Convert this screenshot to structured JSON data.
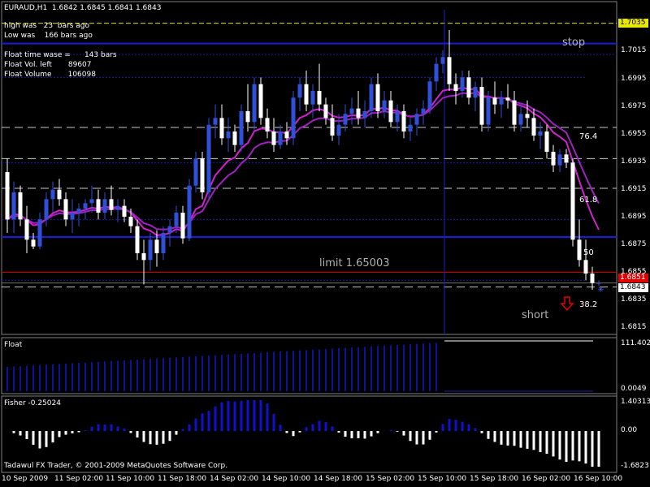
{
  "header": {
    "symbol_line": "EURAUD,H1  1.6842 1.6845 1.6841 1.6843",
    "high_was": "high was   23  bars ago",
    "low_was": "Low was    166 bars ago",
    "float_time": "Float time wase =      143 bars",
    "float_vol_left": "Float Vol. left       89607",
    "float_volume": "Float Volume       106098"
  },
  "labels": {
    "stop": "stop",
    "limit": "limit   1.65003",
    "short": "short",
    "fib_764": "76.4",
    "fib_618": "61.8",
    "fib_50": "50",
    "fib_382": "38.2"
  },
  "price_tags": {
    "high": "1.7035",
    "red": "1.6851",
    "current": "1.6843"
  },
  "y_ticks": [
    "1.7015",
    "1.6995",
    "1.6975",
    "1.6955",
    "1.6935",
    "1.6915",
    "1.6895",
    "1.6875",
    "1.6855",
    "1.6835",
    "1.6815"
  ],
  "x_ticks": [
    "10 Sep 2009",
    "11 Sep 02:00",
    "11 Sep 10:00",
    "11 Sep 18:00",
    "14 Sep 02:00",
    "14 Sep 10:00",
    "14 Sep 18:00",
    "15 Sep 02:00",
    "15 Sep 10:00",
    "15 Sep 18:00",
    "16 Sep 02:00",
    "16 Sep 10:00"
  ],
  "float_panel": {
    "title": "Float",
    "top_value": "111.4029",
    "bottom_value": "0.0049"
  },
  "fisher_panel": {
    "title": "Fisher -0.25024",
    "top_value": "1.40313",
    "zero_value": "0.00",
    "bottom_value": "-1.6823"
  },
  "copyright": "Tadawul FX Trader, © 2001-2009 MetaQuotes Software Corp.",
  "colors": {
    "bull": "#3050d8",
    "bear": "#ffffff",
    "ma": "#d020d0",
    "ma_slow": "#a020c0",
    "level_blue": "#1c1cd8",
    "hist_blue": "#1010a0",
    "high_line": "#e0e000",
    "red": "#e00000"
  },
  "chart_data": {
    "type": "candlestick",
    "symbol": "EURAUD",
    "timeframe": "H1",
    "ylim": [
      1.6805,
      1.7045
    ],
    "candles": [
      {
        "o": 1.6925,
        "h": 1.6935,
        "l": 1.688,
        "c": 1.689
      },
      {
        "o": 1.689,
        "h": 1.6918,
        "l": 1.688,
        "c": 1.691
      },
      {
        "o": 1.691,
        "h": 1.6915,
        "l": 1.6885,
        "c": 1.689
      },
      {
        "o": 1.689,
        "h": 1.69,
        "l": 1.6865,
        "c": 1.6875
      },
      {
        "o": 1.6875,
        "h": 1.688,
        "l": 1.6868,
        "c": 1.687
      },
      {
        "o": 1.687,
        "h": 1.6895,
        "l": 1.6868,
        "c": 1.689
      },
      {
        "o": 1.689,
        "h": 1.691,
        "l": 1.6885,
        "c": 1.6905
      },
      {
        "o": 1.6905,
        "h": 1.6918,
        "l": 1.6895,
        "c": 1.6912
      },
      {
        "o": 1.6912,
        "h": 1.692,
        "l": 1.69,
        "c": 1.6905
      },
      {
        "o": 1.6905,
        "h": 1.691,
        "l": 1.6885,
        "c": 1.689
      },
      {
        "o": 1.689,
        "h": 1.6905,
        "l": 1.688,
        "c": 1.6895
      },
      {
        "o": 1.6895,
        "h": 1.6902,
        "l": 1.6885,
        "c": 1.6898
      },
      {
        "o": 1.6898,
        "h": 1.6905,
        "l": 1.689,
        "c": 1.6902
      },
      {
        "o": 1.6902,
        "h": 1.6915,
        "l": 1.6895,
        "c": 1.6905
      },
      {
        "o": 1.6905,
        "h": 1.6912,
        "l": 1.689,
        "c": 1.6895
      },
      {
        "o": 1.6895,
        "h": 1.691,
        "l": 1.689,
        "c": 1.6905
      },
      {
        "o": 1.6905,
        "h": 1.6915,
        "l": 1.6893,
        "c": 1.6897
      },
      {
        "o": 1.6897,
        "h": 1.6905,
        "l": 1.6888,
        "c": 1.69
      },
      {
        "o": 1.69,
        "h": 1.6905,
        "l": 1.6888,
        "c": 1.6892
      },
      {
        "o": 1.6892,
        "h": 1.6898,
        "l": 1.688,
        "c": 1.6885
      },
      {
        "o": 1.6885,
        "h": 1.689,
        "l": 1.686,
        "c": 1.6865
      },
      {
        "o": 1.6865,
        "h": 1.6875,
        "l": 1.6842,
        "c": 1.686
      },
      {
        "o": 1.686,
        "h": 1.688,
        "l": 1.6852,
        "c": 1.6875
      },
      {
        "o": 1.6875,
        "h": 1.6882,
        "l": 1.6855,
        "c": 1.6865
      },
      {
        "o": 1.6865,
        "h": 1.6885,
        "l": 1.686,
        "c": 1.688
      },
      {
        "o": 1.688,
        "h": 1.689,
        "l": 1.687,
        "c": 1.6885
      },
      {
        "o": 1.6885,
        "h": 1.69,
        "l": 1.688,
        "c": 1.6895
      },
      {
        "o": 1.6895,
        "h": 1.69,
        "l": 1.6872,
        "c": 1.6876
      },
      {
        "o": 1.6876,
        "h": 1.692,
        "l": 1.6874,
        "c": 1.6915
      },
      {
        "o": 1.6915,
        "h": 1.694,
        "l": 1.691,
        "c": 1.6935
      },
      {
        "o": 1.6935,
        "h": 1.694,
        "l": 1.6905,
        "c": 1.691
      },
      {
        "o": 1.691,
        "h": 1.6965,
        "l": 1.6905,
        "c": 1.696
      },
      {
        "o": 1.696,
        "h": 1.6975,
        "l": 1.695,
        "c": 1.6965
      },
      {
        "o": 1.6965,
        "h": 1.6975,
        "l": 1.6945,
        "c": 1.695
      },
      {
        "o": 1.695,
        "h": 1.6965,
        "l": 1.694,
        "c": 1.6955
      },
      {
        "o": 1.6955,
        "h": 1.696,
        "l": 1.694,
        "c": 1.6945
      },
      {
        "o": 1.6945,
        "h": 1.6975,
        "l": 1.694,
        "c": 1.697
      },
      {
        "o": 1.697,
        "h": 1.699,
        "l": 1.6955,
        "c": 1.6962
      },
      {
        "o": 1.6962,
        "h": 1.6995,
        "l": 1.6955,
        "c": 1.699
      },
      {
        "o": 1.699,
        "h": 1.6995,
        "l": 1.696,
        "c": 1.6965
      },
      {
        "o": 1.6965,
        "h": 1.6972,
        "l": 1.695,
        "c": 1.6955
      },
      {
        "o": 1.6955,
        "h": 1.6965,
        "l": 1.694,
        "c": 1.6945
      },
      {
        "o": 1.6945,
        "h": 1.696,
        "l": 1.6942,
        "c": 1.6955
      },
      {
        "o": 1.6955,
        "h": 1.6962,
        "l": 1.6945,
        "c": 1.695
      },
      {
        "o": 1.695,
        "h": 1.6985,
        "l": 1.6945,
        "c": 1.698
      },
      {
        "o": 1.698,
        "h": 1.6995,
        "l": 1.697,
        "c": 1.699
      },
      {
        "o": 1.699,
        "h": 1.7,
        "l": 1.697,
        "c": 1.6975
      },
      {
        "o": 1.6975,
        "h": 1.699,
        "l": 1.6965,
        "c": 1.6985
      },
      {
        "o": 1.6985,
        "h": 1.7005,
        "l": 1.697,
        "c": 1.6975
      },
      {
        "o": 1.6975,
        "h": 1.698,
        "l": 1.696,
        "c": 1.6965
      },
      {
        "o": 1.6965,
        "h": 1.6975,
        "l": 1.6948,
        "c": 1.6952
      },
      {
        "o": 1.6952,
        "h": 1.6968,
        "l": 1.6945,
        "c": 1.696
      },
      {
        "o": 1.696,
        "h": 1.6975,
        "l": 1.6955,
        "c": 1.6968
      },
      {
        "o": 1.6968,
        "h": 1.698,
        "l": 1.696,
        "c": 1.6972
      },
      {
        "o": 1.6972,
        "h": 1.6985,
        "l": 1.696,
        "c": 1.6965
      },
      {
        "o": 1.6965,
        "h": 1.6978,
        "l": 1.6958,
        "c": 1.697
      },
      {
        "o": 1.697,
        "h": 1.6995,
        "l": 1.6965,
        "c": 1.699
      },
      {
        "o": 1.699,
        "h": 1.6998,
        "l": 1.6965,
        "c": 1.697
      },
      {
        "o": 1.697,
        "h": 1.6985,
        "l": 1.6965,
        "c": 1.6978
      },
      {
        "o": 1.6978,
        "h": 1.6985,
        "l": 1.6958,
        "c": 1.6962
      },
      {
        "o": 1.6962,
        "h": 1.6975,
        "l": 1.6955,
        "c": 1.697
      },
      {
        "o": 1.697,
        "h": 1.6975,
        "l": 1.695,
        "c": 1.6955
      },
      {
        "o": 1.6955,
        "h": 1.6965,
        "l": 1.6948,
        "c": 1.696
      },
      {
        "o": 1.696,
        "h": 1.6972,
        "l": 1.6952,
        "c": 1.6968
      },
      {
        "o": 1.6968,
        "h": 1.6978,
        "l": 1.696,
        "c": 1.6972
      },
      {
        "o": 1.6972,
        "h": 1.6995,
        "l": 1.6968,
        "c": 1.6992
      },
      {
        "o": 1.6992,
        "h": 1.701,
        "l": 1.6985,
        "c": 1.7005
      },
      {
        "o": 1.7005,
        "h": 1.7015,
        "l": 1.6998,
        "c": 1.701
      },
      {
        "o": 1.701,
        "h": 1.703,
        "l": 1.6985,
        "c": 1.699
      },
      {
        "o": 1.699,
        "h": 1.6998,
        "l": 1.6975,
        "c": 1.6985
      },
      {
        "o": 1.6985,
        "h": 1.7,
        "l": 1.698,
        "c": 1.6995
      },
      {
        "o": 1.6995,
        "h": 1.7,
        "l": 1.6975,
        "c": 1.698
      },
      {
        "o": 1.698,
        "h": 1.6992,
        "l": 1.697,
        "c": 1.6988
      },
      {
        "o": 1.6988,
        "h": 1.6995,
        "l": 1.6955,
        "c": 1.696
      },
      {
        "o": 1.696,
        "h": 1.6985,
        "l": 1.6955,
        "c": 1.698
      },
      {
        "o": 1.698,
        "h": 1.6992,
        "l": 1.6968,
        "c": 1.6975
      },
      {
        "o": 1.6975,
        "h": 1.6985,
        "l": 1.6965,
        "c": 1.698
      },
      {
        "o": 1.698,
        "h": 1.699,
        "l": 1.6972,
        "c": 1.6978
      },
      {
        "o": 1.6978,
        "h": 1.6985,
        "l": 1.6955,
        "c": 1.696
      },
      {
        "o": 1.696,
        "h": 1.6975,
        "l": 1.6955,
        "c": 1.6968
      },
      {
        "o": 1.6968,
        "h": 1.6978,
        "l": 1.6958,
        "c": 1.6965
      },
      {
        "o": 1.6965,
        "h": 1.6972,
        "l": 1.6948,
        "c": 1.6952
      },
      {
        "o": 1.6952,
        "h": 1.6962,
        "l": 1.6942,
        "c": 1.6955
      },
      {
        "o": 1.6955,
        "h": 1.696,
        "l": 1.6935,
        "c": 1.694
      },
      {
        "o": 1.694,
        "h": 1.6945,
        "l": 1.6925,
        "c": 1.693
      },
      {
        "o": 1.693,
        "h": 1.6942,
        "l": 1.6925,
        "c": 1.6938
      },
      {
        "o": 1.6938,
        "h": 1.6942,
        "l": 1.6928,
        "c": 1.6932
      },
      {
        "o": 1.6932,
        "h": 1.6935,
        "l": 1.687,
        "c": 1.6875
      },
      {
        "o": 1.6875,
        "h": 1.689,
        "l": 1.6855,
        "c": 1.686
      },
      {
        "o": 1.686,
        "h": 1.6875,
        "l": 1.6845,
        "c": 1.685
      },
      {
        "o": 1.685,
        "h": 1.6855,
        "l": 1.6838,
        "c": 1.6843
      },
      {
        "o": 1.6843,
        "h": 1.6845,
        "l": 1.6841,
        "c": 1.6843
      }
    ],
    "levels": {
      "high": 1.7035,
      "stop": 1.7012,
      "fib_76_4": 1.6958,
      "fib_61_8": 1.6913,
      "fib_50": 1.6877,
      "fib_38_2": 1.684,
      "limit": 1.65003,
      "red": 1.6851,
      "current": 1.6843
    },
    "float_panel": {
      "ylim": [
        0.0049,
        111.4029
      ]
    },
    "fisher_panel": {
      "ylim": [
        -1.6823,
        1.40313
      ]
    }
  }
}
